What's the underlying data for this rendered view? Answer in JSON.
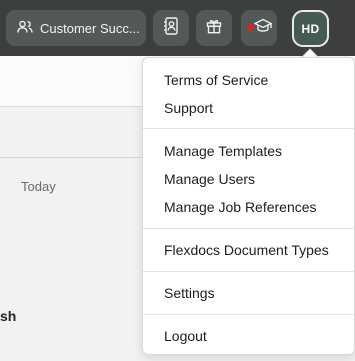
{
  "header": {
    "team_label": "Customer Succ...",
    "team_icon": "users-icon",
    "contacts_icon": "address-book-icon",
    "gift_icon": "gift-icon",
    "learn_icon": "graduation-cap-icon",
    "notification_dot_color": "#d8232a",
    "avatar_initials": "HD"
  },
  "content": {
    "today_label": "Today",
    "partial_text": "sh"
  },
  "menu": {
    "group1": [
      "Terms of Service",
      "Support"
    ],
    "group2": [
      "Manage Templates",
      "Manage Users",
      "Manage Job References"
    ],
    "group3": [
      "Flexdocs Document Types"
    ],
    "group4": [
      "Settings"
    ],
    "group5": [
      "Logout"
    ]
  }
}
